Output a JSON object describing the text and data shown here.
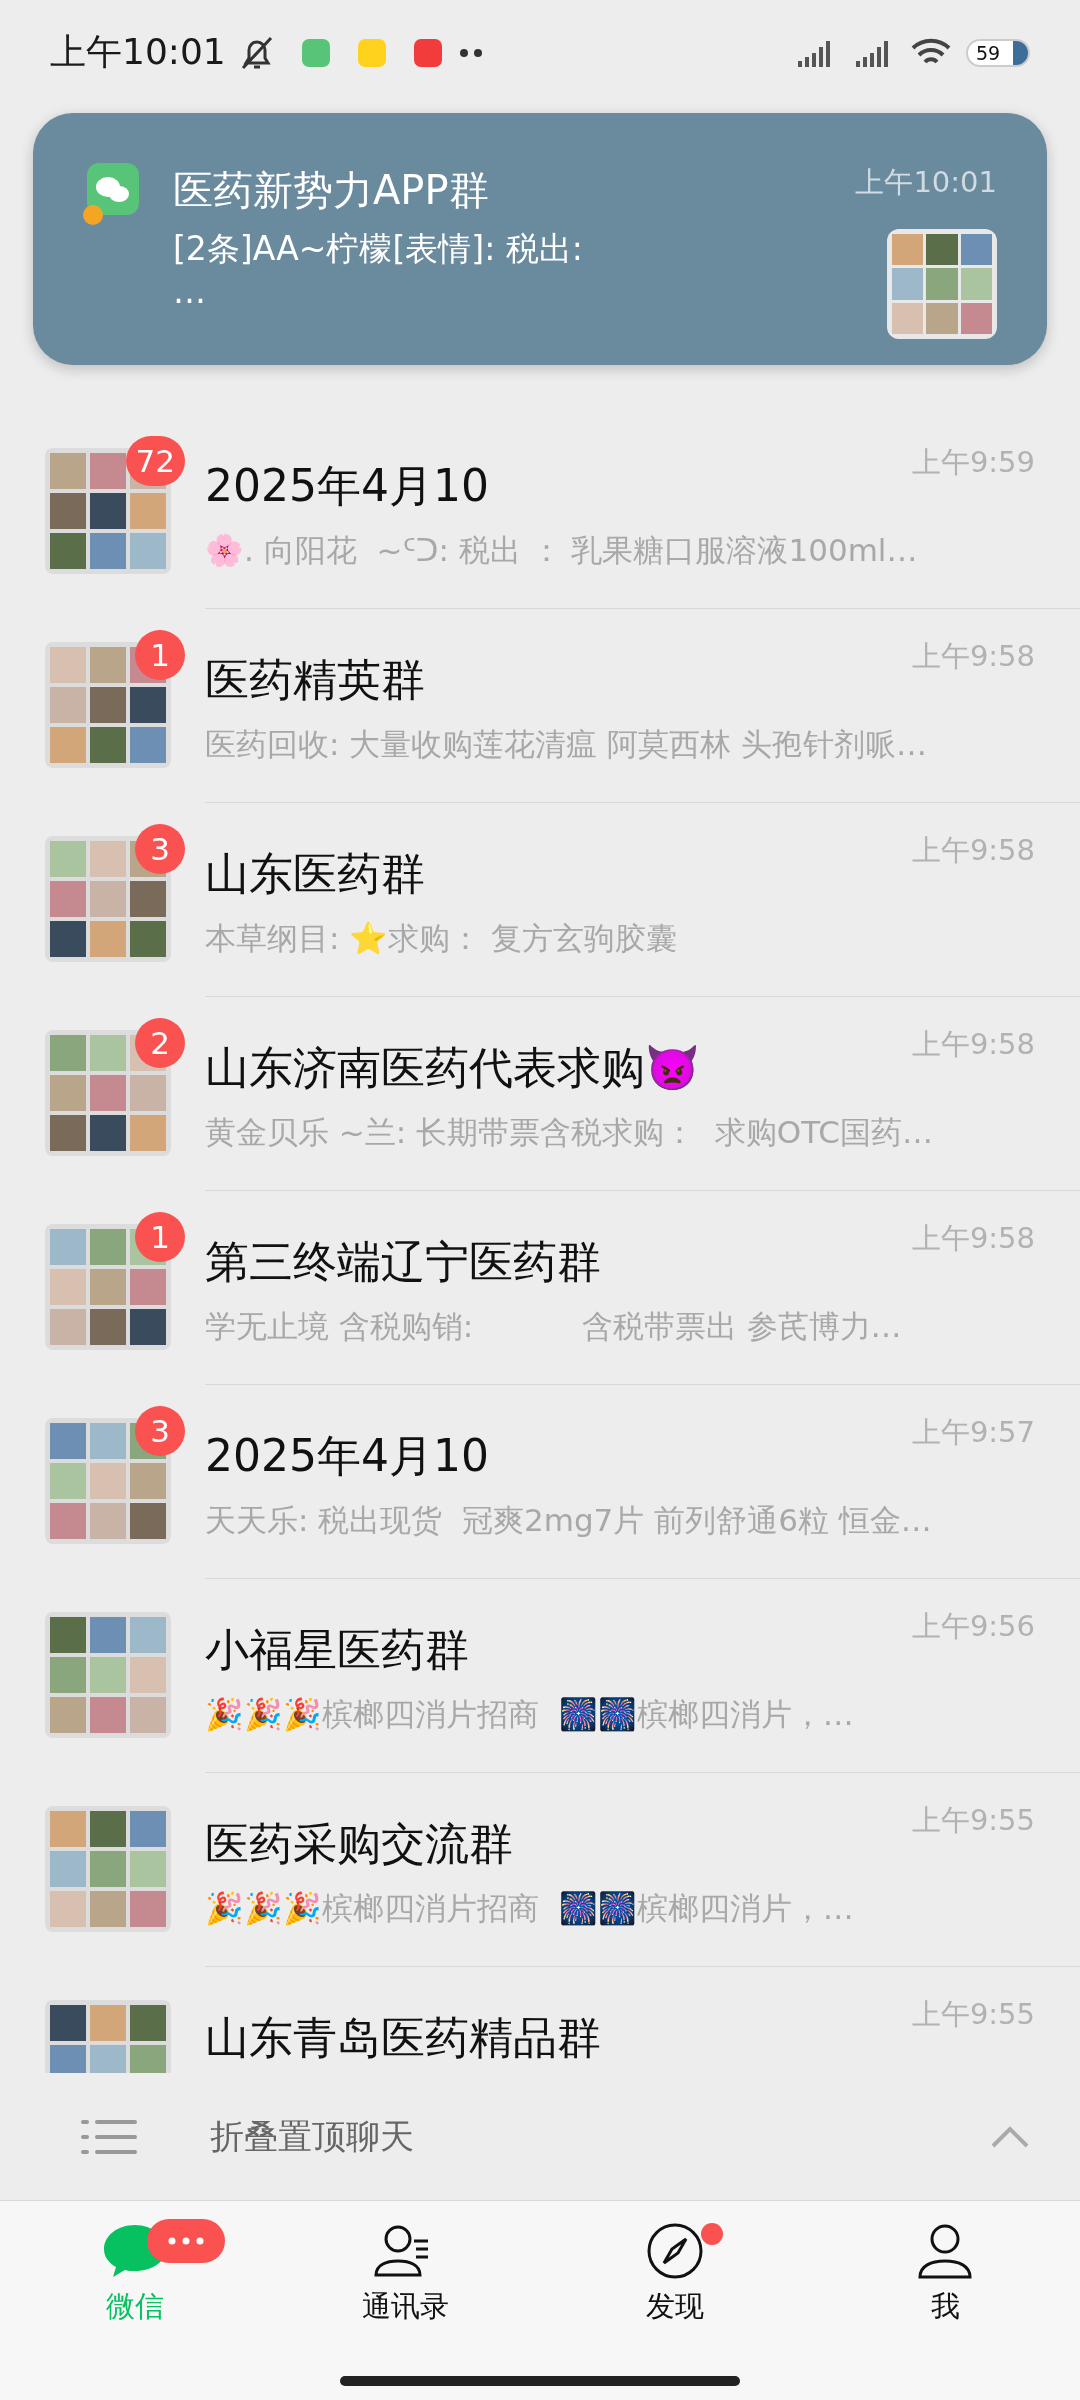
{
  "status_bar": {
    "time": "上午10:01",
    "battery": "59"
  },
  "notification": {
    "title": "医药新势力APP群",
    "time": "上午10:01",
    "message": "[2条]AA~柠檬[表情]: 税出:\n…"
  },
  "chats": [
    {
      "title": "2025年4月10",
      "preview": "🌸. 向阳花  ~ᑦᑐ: 税出 ： 乳果糖口服溶液100ml…",
      "time": "上午9:59",
      "badge": "72"
    },
    {
      "title": "医药精英群",
      "preview": "医药回收: 大量收购莲花清瘟 阿莫西林 头孢针剂哌…",
      "time": "上午9:58",
      "badge": "1"
    },
    {
      "title": "山东医药群",
      "preview": "本草纲目: ⭐求购： 复方玄驹胶囊",
      "time": "上午9:58",
      "badge": "3"
    },
    {
      "title": "山东济南医药代表求购👿",
      "preview": "黄金贝乐 ~兰: 长期带票含税求购：  求购OTC国药…",
      "time": "上午9:58",
      "badge": "2"
    },
    {
      "title": "第三终端辽宁医药群",
      "preview": "学无止境 含税购销:           含税带票出 参芪博力…",
      "time": "上午9:58",
      "badge": "1"
    },
    {
      "title": "2025年4月10",
      "preview": "天天乐: 税出现货  冠爽2mg7片 前列舒通6粒 恒金…",
      "time": "上午9:57",
      "badge": "3"
    },
    {
      "title": "小福星医药群",
      "preview": "🎉🎉🎉槟榔四消片招商  🎆🎆槟榔四消片，…",
      "time": "上午9:56"
    },
    {
      "title": "医药采购交流群",
      "preview": "🎉🎉🎉槟榔四消片招商  🎆🎆槟榔四消片，…",
      "time": "上午9:55"
    },
    {
      "title": "山东青岛医药精品群",
      "time": "上午9:55"
    }
  ],
  "folded_bar": {
    "label": "折叠置顶聊天"
  },
  "tabs": [
    {
      "label": "微信",
      "kind": "chat",
      "selected": true,
      "unread_pill": true
    },
    {
      "label": "通讯录",
      "kind": "contacts",
      "selected": false
    },
    {
      "label": "发现",
      "kind": "discover",
      "selected": false,
      "unread_dot": true
    },
    {
      "label": "我",
      "kind": "me",
      "selected": false
    }
  ]
}
